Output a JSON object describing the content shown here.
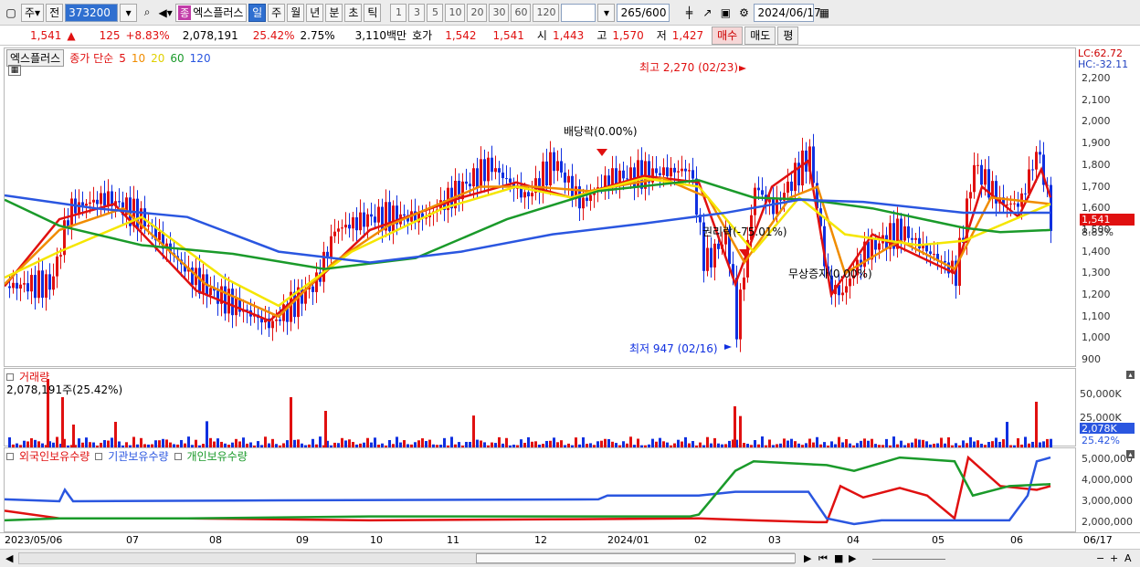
{
  "toolbar": {
    "market": "주",
    "type": "전",
    "code": "373200",
    "badge": "종",
    "name": "엑스플러스",
    "periods": [
      "일",
      "주",
      "월",
      "년",
      "분",
      "초",
      "틱"
    ],
    "active_period": "일",
    "intervals": [
      "1",
      "3",
      "5",
      "10",
      "20",
      "30",
      "60",
      "120"
    ],
    "count": "265",
    "count_total": "/600",
    "date": "2024/06/17"
  },
  "quote": {
    "price": "1,541",
    "direction_symbol": "▲",
    "change": "125",
    "change_pct": "+8.83%",
    "volume": "2,078,191",
    "volume_pct": "25.42%",
    "turnover": "2.75%",
    "amount": "3,110백만",
    "hoga_label": "호가",
    "ask": "1,542",
    "bid": "1,541",
    "open_label": "시",
    "open": "1,443",
    "high_label": "고",
    "high": "1,570",
    "low_label": "저",
    "low": "1,427",
    "buy_btn": "매수",
    "sell_btn": "매도",
    "eval_btn": "평"
  },
  "price_pane": {
    "name_chip": "엑스플러스",
    "ma_title": "종가 단순",
    "ma_periods": [
      {
        "label": "5",
        "color": "#e01010"
      },
      {
        "label": "10",
        "color": "#f08c00"
      },
      {
        "label": "20",
        "color": "#f5e600"
      },
      {
        "label": "60",
        "color": "#1a9a2a"
      },
      {
        "label": "120",
        "color": "#2a56e0"
      }
    ],
    "lc": "LC:62.72",
    "hc": "HC:-32.11",
    "current_price": "1,541",
    "current_pct": "8.83%",
    "annotations": {
      "high": "최고 2,270 (02/23)",
      "low": "최저 947 (02/16)",
      "dividend": "배당락(0.00%)",
      "reverse_split": "권리락(-75.01%)",
      "bonus": "무상증자(0.00%)"
    },
    "y_axis": [
      "2,200",
      "2,100",
      "2,000",
      "1,900",
      "1,800",
      "1,700",
      "1,600",
      "1,500",
      "1,400",
      "1,300",
      "1,200",
      "1,100",
      "1,000",
      "900"
    ]
  },
  "volume_pane": {
    "title": "거래량",
    "value": "2,078,191주(25.42%)",
    "y_axis": [
      "50,000K",
      "25,000K"
    ],
    "current": "2,078K",
    "current_pct": "25.42%"
  },
  "holding_pane": {
    "series": [
      {
        "name": "외국인보유수량",
        "color": "#e01010"
      },
      {
        "name": "기관보유수량",
        "color": "#2a56e0"
      },
      {
        "name": "개인보유수량",
        "color": "#1a9a2a"
      }
    ],
    "y_axis": [
      "5,000,000",
      "4,000,000",
      "3,000,000",
      "2,000,000"
    ]
  },
  "x_axis": [
    "2023/05/06",
    "07",
    "08",
    "09",
    "10",
    "11",
    "12",
    "2024/01",
    "02",
    "03",
    "04",
    "05",
    "06"
  ],
  "x_axis_end": "06/17",
  "colors": {
    "up": "#e01010",
    "down": "#1030e0",
    "accent": "#2f6fd0"
  }
}
